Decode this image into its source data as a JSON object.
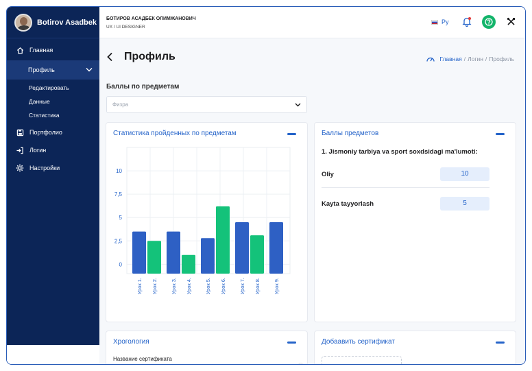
{
  "user": {
    "name": "Botirov Asadbek"
  },
  "sidebar": {
    "items": [
      {
        "label": "Главная",
        "icon": "home-icon"
      },
      {
        "label": "Профиль",
        "icon": "chevron-down-icon"
      },
      {
        "label": "Портфолио",
        "icon": "save-icon"
      },
      {
        "label": "Логин",
        "icon": "login-icon"
      },
      {
        "label": "Настройки",
        "icon": "gear-icon"
      }
    ],
    "subitems": [
      {
        "label": "Редактировать"
      },
      {
        "label": "Данные"
      },
      {
        "label": "Статистика"
      }
    ]
  },
  "topbar": {
    "fio": "БОТИРОВ АСАДБЕК ОЛИМЖАНОВИЧ",
    "role": "UX / UI DESIGNER",
    "lang": "Ру"
  },
  "page": {
    "title": "Профиль",
    "breadcrumb": {
      "home": "Главная",
      "sep1": "/",
      "mid": "Логин",
      "sep2": "/",
      "current": "Профиль"
    },
    "section_label": "Баллы по предметам",
    "select_placeholder": "Физра"
  },
  "cards": {
    "stats": {
      "title": "Статистика пройденных по предметам"
    },
    "scores": {
      "title": "Баллы предметов",
      "heading": "1. Jismoniy tarbiya va sport soxdsidagi ma'lumoti:",
      "rows": [
        {
          "name": "Oliy",
          "value": "10"
        },
        {
          "name": "Kayta tayyorlash",
          "value": "5"
        }
      ]
    },
    "chronology": {
      "title": "Хрогология",
      "field_label": "Название сертификата"
    },
    "certificate": {
      "title": "Добаавить сертификат"
    }
  },
  "colors": {
    "sidebar": "#0c2557",
    "accent": "#2463c9",
    "blue_bar": "#2e60c4",
    "green_bar": "#14c27a"
  },
  "chart_data": {
    "type": "bar",
    "categories": [
      "Урок 1.",
      "Урок 2.",
      "Урок 3.",
      "Урок 4.",
      "Урок 5.",
      "Урок 6.",
      "Урок 7.",
      "Урок 8.",
      "Урок 9."
    ],
    "values": [
      3.5,
      2.5,
      3.5,
      1.0,
      2.8,
      6.2,
      4.5,
      3.1,
      4.5
    ],
    "bar_colors": [
      "blue",
      "green",
      "blue",
      "green",
      "blue",
      "green",
      "blue",
      "green",
      "blue"
    ],
    "yticks": [
      "0",
      "2,5",
      "5",
      "7,5",
      "10"
    ],
    "ylim": [
      -1,
      12.5
    ],
    "grid": true
  }
}
